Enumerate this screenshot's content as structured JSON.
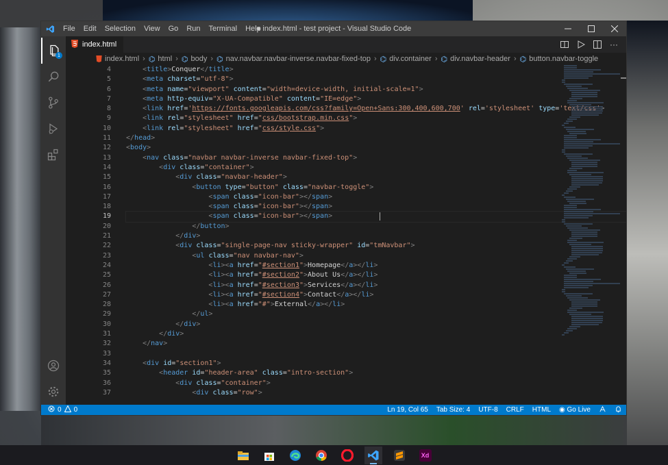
{
  "window": {
    "title": "● index.html - test project - Visual Studio Code",
    "menu": [
      "File",
      "Edit",
      "Selection",
      "View",
      "Go",
      "Run",
      "Terminal",
      "Help"
    ],
    "controls": [
      "minimize",
      "maximize",
      "close"
    ]
  },
  "activity_bar": {
    "items": [
      "explorer",
      "search",
      "source-control",
      "run-debug",
      "extensions"
    ],
    "explorer_badge": "1",
    "bottom_items": [
      "accounts",
      "manage"
    ]
  },
  "tab": {
    "label": "index.html",
    "dirty": true
  },
  "breadcrumb": [
    "index.html",
    "html",
    "body",
    "nav.navbar.navbar-inverse.navbar-fixed-top",
    "div.container",
    "div.navbar-header",
    "button.navbar-toggle"
  ],
  "editor": {
    "current_line": 19,
    "line_numbers": [
      "4",
      "5",
      "6",
      "7",
      "8",
      "9",
      "10",
      "11",
      "12",
      "13",
      "14",
      "15",
      "16",
      "17",
      "18",
      "19",
      "20",
      "21",
      "22",
      "23",
      "24",
      "25",
      "26",
      "27",
      "28",
      "29",
      "30",
      "31",
      "32",
      "33",
      "34",
      "35",
      "36",
      "37"
    ],
    "lines": [
      "    <title>Conquer</title>",
      "    <meta charset=\"utf-8\">",
      "    <meta name=\"viewport\" content=\"width=device-width, initial-scale=1\">",
      "    <meta http-equiv=\"X-UA-Compatible\" content=\"IE=edge\">",
      "    <link href='https://fonts.googleapis.com/css?family=Open+Sans:300,400,600,700' rel='stylesheet' type='text/css'>",
      "    <link rel=\"stylesheet\" href=\"css/bootstrap.min.css\">",
      "    <link rel=\"stylesheet\" href=\"css/style.css\">",
      "</head>",
      "<body>",
      "    <nav class=\"navbar navbar-inverse navbar-fixed-top\">",
      "        <div class=\"container\">",
      "            <div class=\"navbar-header\">",
      "                <button type=\"button\" class=\"navbar-toggle\">",
      "                    <span class=\"icon-bar\"></span>",
      "                    <span class=\"icon-bar\"></span>",
      "                    <span class=\"icon-bar\"></span>",
      "                </button>",
      "            </div>",
      "            <div class=\"single-page-nav sticky-wrapper\" id=\"tmNavbar\">",
      "                <ul class=\"nav navbar-nav\">",
      "                    <li><a href=\"#section1\">Homepage</a></li>",
      "                    <li><a href=\"#section2\">About Us</a></li>",
      "                    <li><a href=\"#section3\">Services</a></li>",
      "                    <li><a href=\"#section4\">Contact</a></li>",
      "                    <li><a href=\"#\">External</a></li>",
      "                </ul>",
      "            </div>",
      "        </div>",
      "    </nav>",
      "",
      "    <div id=\"section1\">",
      "        <header id=\"header-area\" class=\"intro-section\">",
      "            <div class=\"container\">",
      "                <div class=\"row\">"
    ]
  },
  "status_bar": {
    "problems_errors": "0",
    "problems_warnings": "0",
    "position": "Ln 19, Col 65",
    "tab_size": "Tab Size: 4",
    "encoding": "UTF-8",
    "eol": "CRLF",
    "language": "HTML",
    "live": "Go Live"
  },
  "taskbar": {
    "apps": [
      "file-explorer",
      "microsoft-store",
      "edge",
      "chrome",
      "opera",
      "vscode",
      "sublime-text",
      "adobe-xd"
    ],
    "xd_label": "Xd"
  },
  "colors": {
    "accent": "#007acc",
    "editor_bg": "#1e1e1e",
    "titlebar_bg": "#3c3c3c",
    "activitybar_bg": "#333333",
    "tag": "#569cd6",
    "attr": "#9cdcfe",
    "string": "#ce9178"
  }
}
